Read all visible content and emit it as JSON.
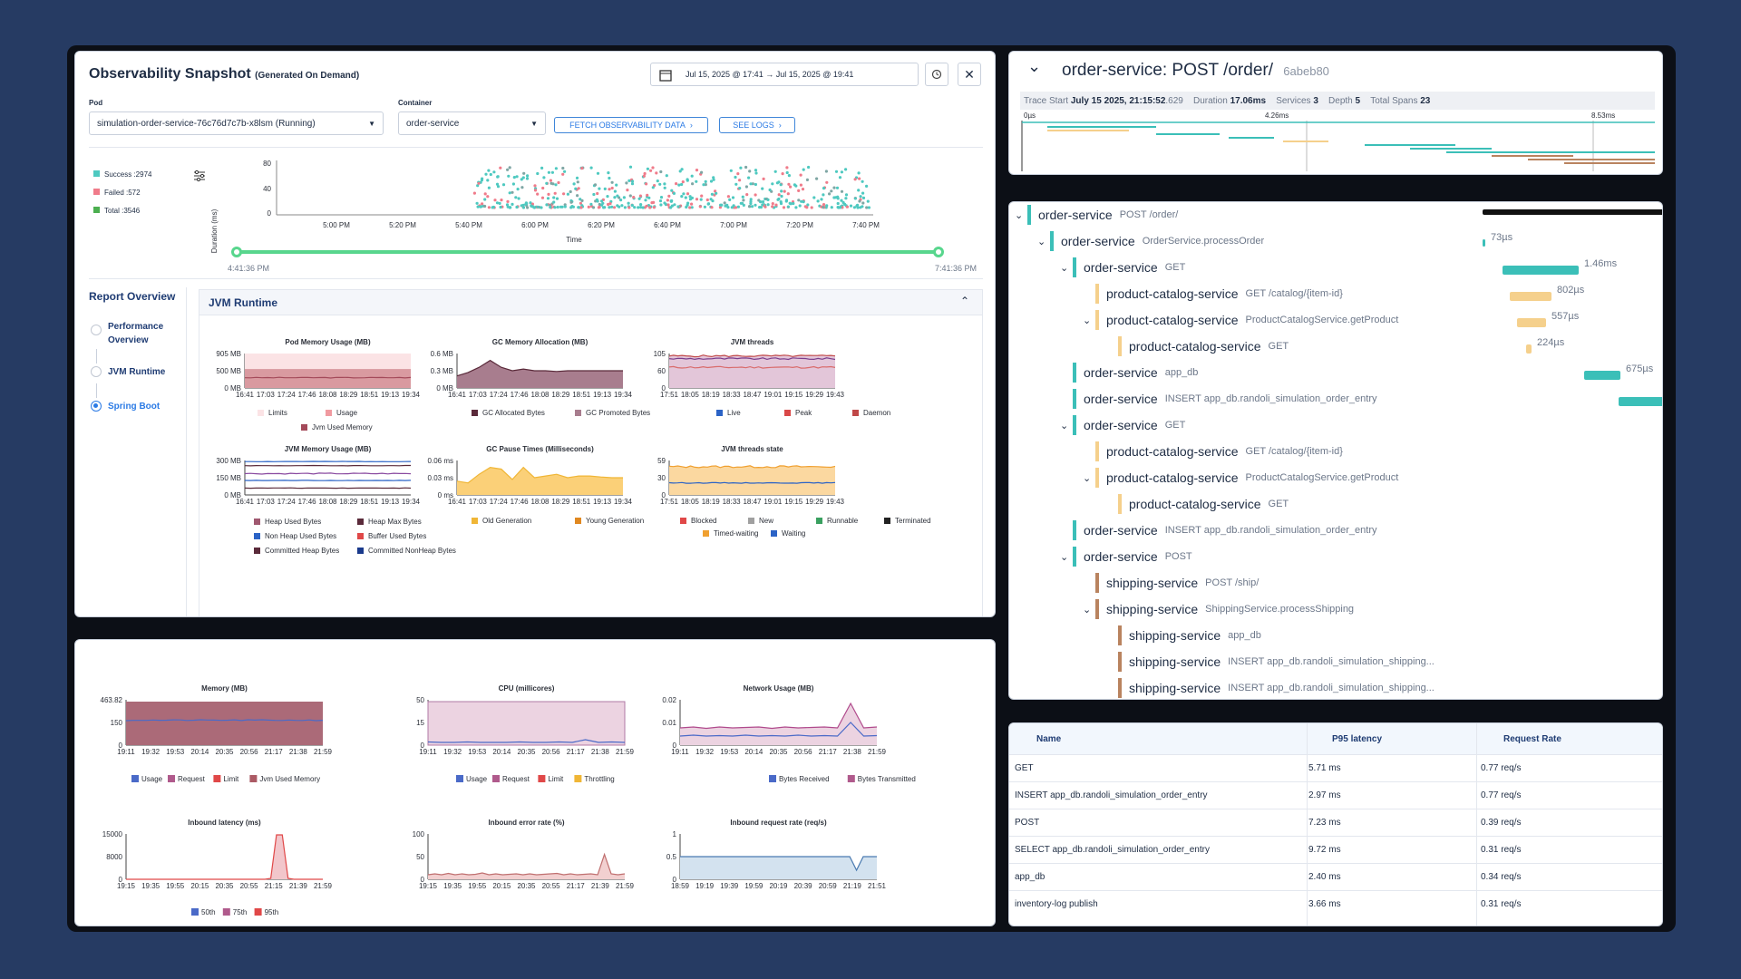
{
  "snapshot": {
    "title": "Observability Snapshot",
    "subtitle": "(Generated On Demand)",
    "date_range": "Jul 15, 2025 @ 17:41  →  Jul 15, 2025 @ 19:41",
    "pod_label": "Pod",
    "pod_value": "simulation-order-service-76c76d7c7b-x8lsm (Running)",
    "container_label": "Container",
    "container_value": "order-service",
    "fetch_btn": "FETCH OBSERVABILITY DATA",
    "logs_btn": "SEE LOGS",
    "scatter_legend": [
      "Success :2974",
      "Failed :572",
      "Total :3546"
    ],
    "scatter_yticks": [
      "80",
      "40",
      "0"
    ],
    "scatter_ylabel": "Duration (ms)",
    "scatter_xticks": [
      "5:00 PM",
      "5:20 PM",
      "5:40 PM",
      "6:00 PM",
      "6:20 PM",
      "6:40 PM",
      "7:00 PM",
      "7:20 PM",
      "7:40 PM"
    ],
    "scatter_xlabel": "Time",
    "slider_start": "4:41:36 PM",
    "slider_end": "7:41:36 PM"
  },
  "report": {
    "title": "Report Overview",
    "items": [
      "Performance Overview",
      "JVM Runtime",
      "Spring Boot"
    ],
    "section_title": "JVM Runtime"
  },
  "jvm_charts": {
    "pod_mem": {
      "title": "Pod Memory Usage (MB)",
      "yticks": [
        "905 MB",
        "500 MB",
        "0 MB"
      ],
      "legend": [
        "Limits",
        "Usage",
        "Jvm Used Memory"
      ]
    },
    "gc_alloc": {
      "title": "GC Memory Allocation (MB)",
      "yticks": [
        "0.6 MB",
        "0.3 MB",
        "0 MB"
      ],
      "legend": [
        "GC Allocated Bytes",
        "GC Promoted Bytes"
      ]
    },
    "jvm_threads": {
      "title": "JVM threads",
      "yticks": [
        "105",
        "60",
        "0"
      ],
      "legend": [
        "Live",
        "Peak",
        "Daemon"
      ]
    },
    "jvm_mem": {
      "title": "JVM Memory Usage (MB)",
      "yticks": [
        "300 MB",
        "150 MB",
        "0 MB"
      ],
      "legend": [
        "Heap Used Bytes",
        "Heap Max Bytes",
        "Non Heap Used Bytes",
        "Buffer Used Bytes",
        "Committed Heap Bytes",
        "Committed NonHeap Bytes"
      ]
    },
    "gc_pause": {
      "title": "GC Pause Times (Milliseconds)",
      "yticks": [
        "0.06 ms",
        "0.03 ms",
        "0 ms"
      ],
      "legend": [
        "Old Generation",
        "Young Generation"
      ]
    },
    "thread_state": {
      "title": "JVM threads state",
      "yticks": [
        "59",
        "30",
        "0"
      ],
      "legend": [
        "Blocked",
        "New",
        "Runnable",
        "Terminated",
        "Timed-waiting",
        "Waiting"
      ]
    },
    "xticks_a": [
      "16:41",
      "17:03",
      "17:24",
      "17:46",
      "18:08",
      "18:29",
      "18:51",
      "19:13",
      "19:34"
    ],
    "xticks_b": [
      "17:51",
      "18:05",
      "18:19",
      "18:33",
      "18:47",
      "19:01",
      "19:15",
      "19:29",
      "19:43"
    ]
  },
  "bottom_charts": {
    "memory": {
      "title": "Memory (MB)",
      "yticks": [
        "463.82",
        "150",
        "0"
      ],
      "legend": [
        "Usage",
        "Request",
        "Limit",
        "Jvm Used Memory"
      ]
    },
    "cpu": {
      "title": "CPU (millicores)",
      "yticks": [
        "50",
        "15",
        "0"
      ],
      "legend": [
        "Usage",
        "Request",
        "Limit",
        "Throttling"
      ]
    },
    "network": {
      "title": "Network Usage (MB)",
      "yticks": [
        "0.02",
        "0.01",
        "0"
      ],
      "legend": [
        "Bytes Received",
        "Bytes Transmitted"
      ]
    },
    "latency": {
      "title": "Inbound latency (ms)",
      "yticks": [
        "15000",
        "8000",
        "0"
      ],
      "legend": [
        "50th",
        "75th",
        "95th"
      ]
    },
    "error_rate": {
      "title": "Inbound error rate (%)",
      "yticks": [
        "100",
        "50",
        "0"
      ]
    },
    "req_rate": {
      "title": "Inbound request rate (req/s)",
      "yticks": [
        "1",
        "0.5",
        "0"
      ]
    },
    "xticks_top": [
      "19:11",
      "19:32",
      "19:53",
      "20:14",
      "20:35",
      "20:56",
      "21:17",
      "21:38",
      "21:59"
    ],
    "xticks_lat": [
      "19:15",
      "19:35",
      "19:55",
      "20:15",
      "20:35",
      "20:55",
      "21:15",
      "21:39",
      "21:59"
    ],
    "xticks_err": [
      "19:15",
      "19:35",
      "19:55",
      "20:15",
      "20:35",
      "20:55",
      "21:17",
      "21:39",
      "21:59"
    ],
    "xticks_req": [
      "18:59",
      "19:19",
      "19:39",
      "19:59",
      "20:19",
      "20:39",
      "20:59",
      "21:19",
      "21:51"
    ]
  },
  "trace": {
    "title": "order-service: POST /order/",
    "trace_id": "6abeb80",
    "start_label": "Trace Start",
    "start_value": "July 15 2025, 21:15:52",
    "start_ms": ".629",
    "duration_label": "Duration",
    "duration_value": "17.06ms",
    "services_label": "Services",
    "services_value": "3",
    "depth_label": "Depth",
    "depth_value": "5",
    "spans_label": "Total Spans",
    "spans_value": "23",
    "ticks": [
      "0µs",
      "4.26ms",
      "8.53ms"
    ],
    "spans": [
      {
        "svc": "order-service",
        "op": "POST /order/",
        "dur": ""
      },
      {
        "svc": "order-service",
        "op": "OrderService.processOrder",
        "dur": "73µs"
      },
      {
        "svc": "order-service",
        "op": "GET",
        "dur": "1.46ms"
      },
      {
        "svc": "product-catalog-service",
        "op": "GET /catalog/{item-id}",
        "dur": "802µs"
      },
      {
        "svc": "product-catalog-service",
        "op": "ProductCatalogService.getProduct",
        "dur": "557µs"
      },
      {
        "svc": "product-catalog-service",
        "op": "GET",
        "dur": "224µs"
      },
      {
        "svc": "order-service",
        "op": "app_db",
        "dur": "675µs"
      },
      {
        "svc": "order-service",
        "op": "INSERT app_db.randoli_simulation_order_entry",
        "dur": ""
      },
      {
        "svc": "order-service",
        "op": "GET",
        "dur": ""
      },
      {
        "svc": "product-catalog-service",
        "op": "GET /catalog/{item-id}",
        "dur": ""
      },
      {
        "svc": "product-catalog-service",
        "op": "ProductCatalogService.getProduct",
        "dur": ""
      },
      {
        "svc": "product-catalog-service",
        "op": "GET",
        "dur": ""
      },
      {
        "svc": "order-service",
        "op": "INSERT app_db.randoli_simulation_order_entry",
        "dur": ""
      },
      {
        "svc": "order-service",
        "op": "POST",
        "dur": ""
      },
      {
        "svc": "shipping-service",
        "op": "POST /ship/",
        "dur": ""
      },
      {
        "svc": "shipping-service",
        "op": "ShippingService.processShipping",
        "dur": ""
      },
      {
        "svc": "shipping-service",
        "op": "app_db",
        "dur": ""
      },
      {
        "svc": "shipping-service",
        "op": "INSERT app_db.randoli_simulation_shipping...",
        "dur": ""
      },
      {
        "svc": "shipping-service",
        "op": "INSERT app_db.randoli_simulation_shipping...",
        "dur": ""
      }
    ]
  },
  "ops_table": {
    "headers": [
      "Name",
      "P95 latency",
      "Request Rate"
    ],
    "rows": [
      [
        "GET",
        "5.71 ms",
        "0.77 req/s"
      ],
      [
        "INSERT app_db.randoli_simulation_order_entry",
        "2.97 ms",
        "0.77 req/s"
      ],
      [
        "POST",
        "7.23 ms",
        "0.39 req/s"
      ],
      [
        "SELECT app_db.randoli_simulation_order_entry",
        "9.72 ms",
        "0.31 req/s"
      ],
      [
        "app_db",
        "2.40 ms",
        "0.34 req/s"
      ],
      [
        "inventory-log publish",
        "3.66 ms",
        "0.31 req/s"
      ]
    ]
  },
  "colors": {
    "success": "#4ec9c0",
    "failed": "#f07b8a",
    "total": "#4caf50",
    "accent": "#2c7be5",
    "order": "#3bbfb8",
    "catalog": "#f5d08c",
    "shipping": "#b9835f"
  }
}
